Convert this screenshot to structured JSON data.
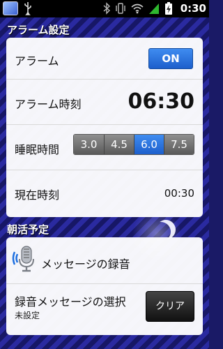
{
  "status_bar": {
    "time": "0:30",
    "left_icons": [
      "notification-thumbnail-icon",
      "usb-icon"
    ],
    "right_icons": [
      "bluetooth-icon",
      "vibrate-icon",
      "wifi-icon",
      "signal-icon",
      "battery-charging-icon"
    ]
  },
  "alarm_section": {
    "title": "アラーム設定",
    "rows": {
      "alarm": {
        "label": "アラーム",
        "toggle_label": "ON",
        "toggle_on": true
      },
      "alarm_time": {
        "label": "アラーム時刻",
        "value": "06:30"
      },
      "sleep_time": {
        "label": "睡眠時間",
        "options": [
          "3.0",
          "4.5",
          "6.0",
          "7.5"
        ],
        "selected": "6.0"
      },
      "current_time": {
        "label": "現在時刻",
        "value": "00:30"
      }
    }
  },
  "morning_section": {
    "title": "朝活予定",
    "rows": {
      "record": {
        "label": "メッセージの録音",
        "icon": "microphone-icon"
      },
      "select": {
        "label": "録音メッセージの選択",
        "sublabel": "未設定",
        "button_label": "クリア"
      }
    }
  },
  "colors": {
    "accent_blue": "#1d5fcc",
    "background_stripe_dark": "#171766",
    "background_stripe_light": "#2a2aa0"
  }
}
